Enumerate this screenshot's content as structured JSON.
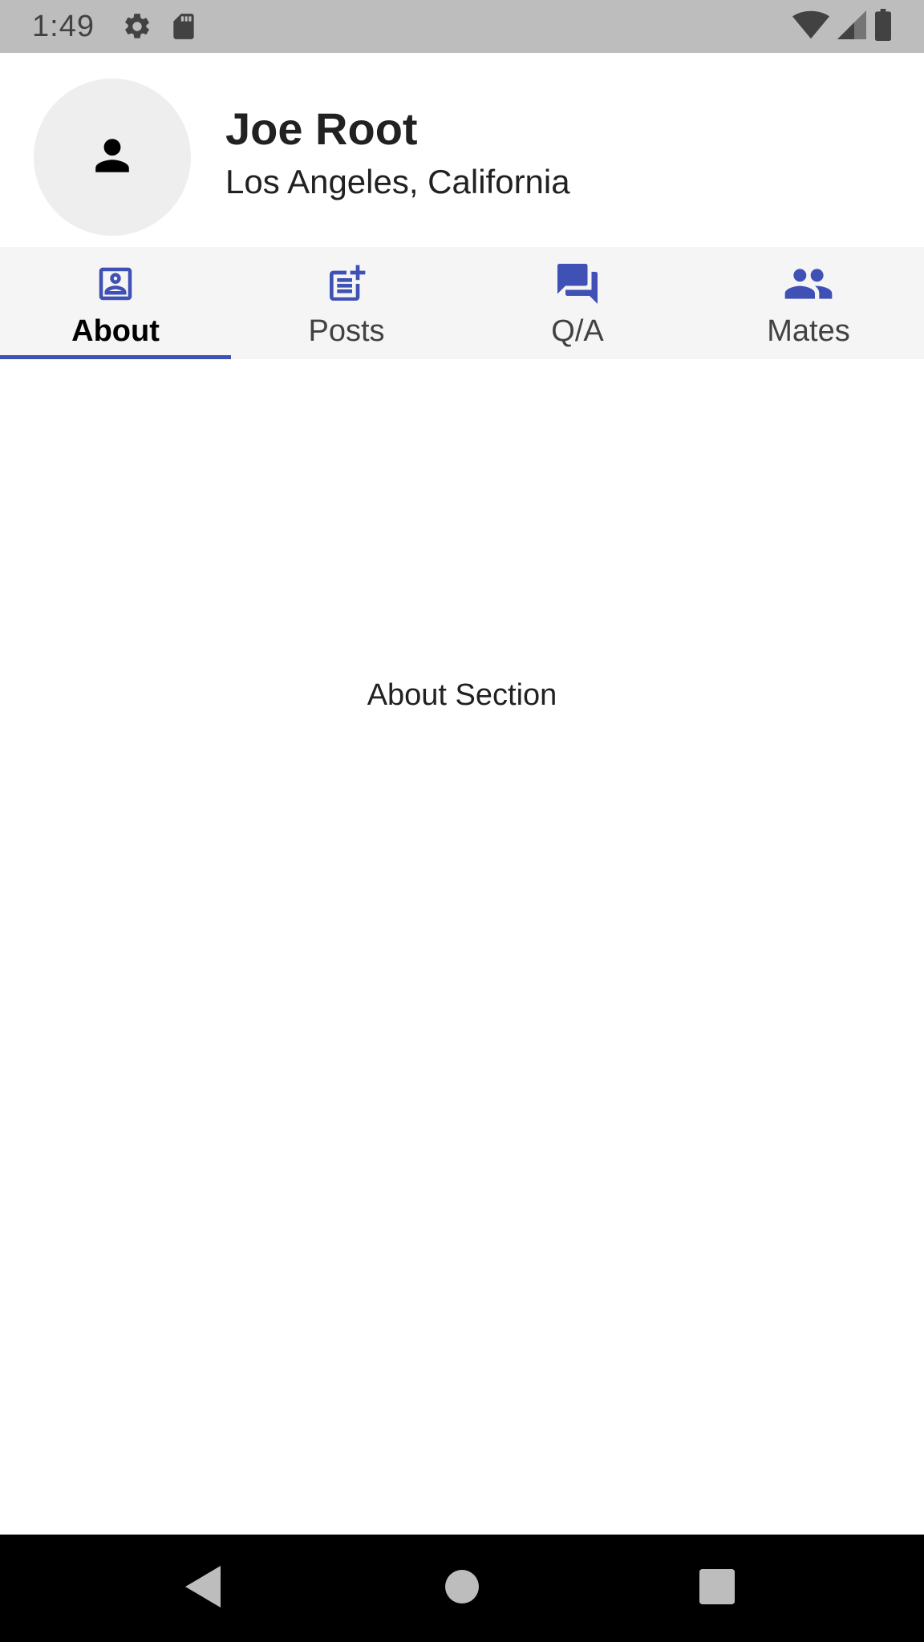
{
  "status_bar": {
    "time": "1:49",
    "icons_left": [
      "gear-icon",
      "sd-card-icon"
    ],
    "icons_right": [
      "wifi-icon",
      "cell-signal-icon",
      "battery-icon"
    ]
  },
  "profile": {
    "name": "Joe Root",
    "location": "Los Angeles, California",
    "avatar_icon": "person-icon"
  },
  "tabs": [
    {
      "label": "About",
      "icon": "contact-card-icon",
      "active": true
    },
    {
      "label": "Posts",
      "icon": "post-add-icon",
      "active": false
    },
    {
      "label": "Q/A",
      "icon": "forum-icon",
      "active": false
    },
    {
      "label": "Mates",
      "icon": "group-icon",
      "active": false
    }
  ],
  "content": {
    "text": "About Section"
  },
  "nav_bar": {
    "buttons": [
      "back-icon",
      "home-icon",
      "recents-icon"
    ]
  },
  "colors": {
    "accent": "#3f51b5",
    "status_bar": "#bdbdbd",
    "tab_bar": "#f5f5f5",
    "avatar_bg": "#eeeeee"
  }
}
